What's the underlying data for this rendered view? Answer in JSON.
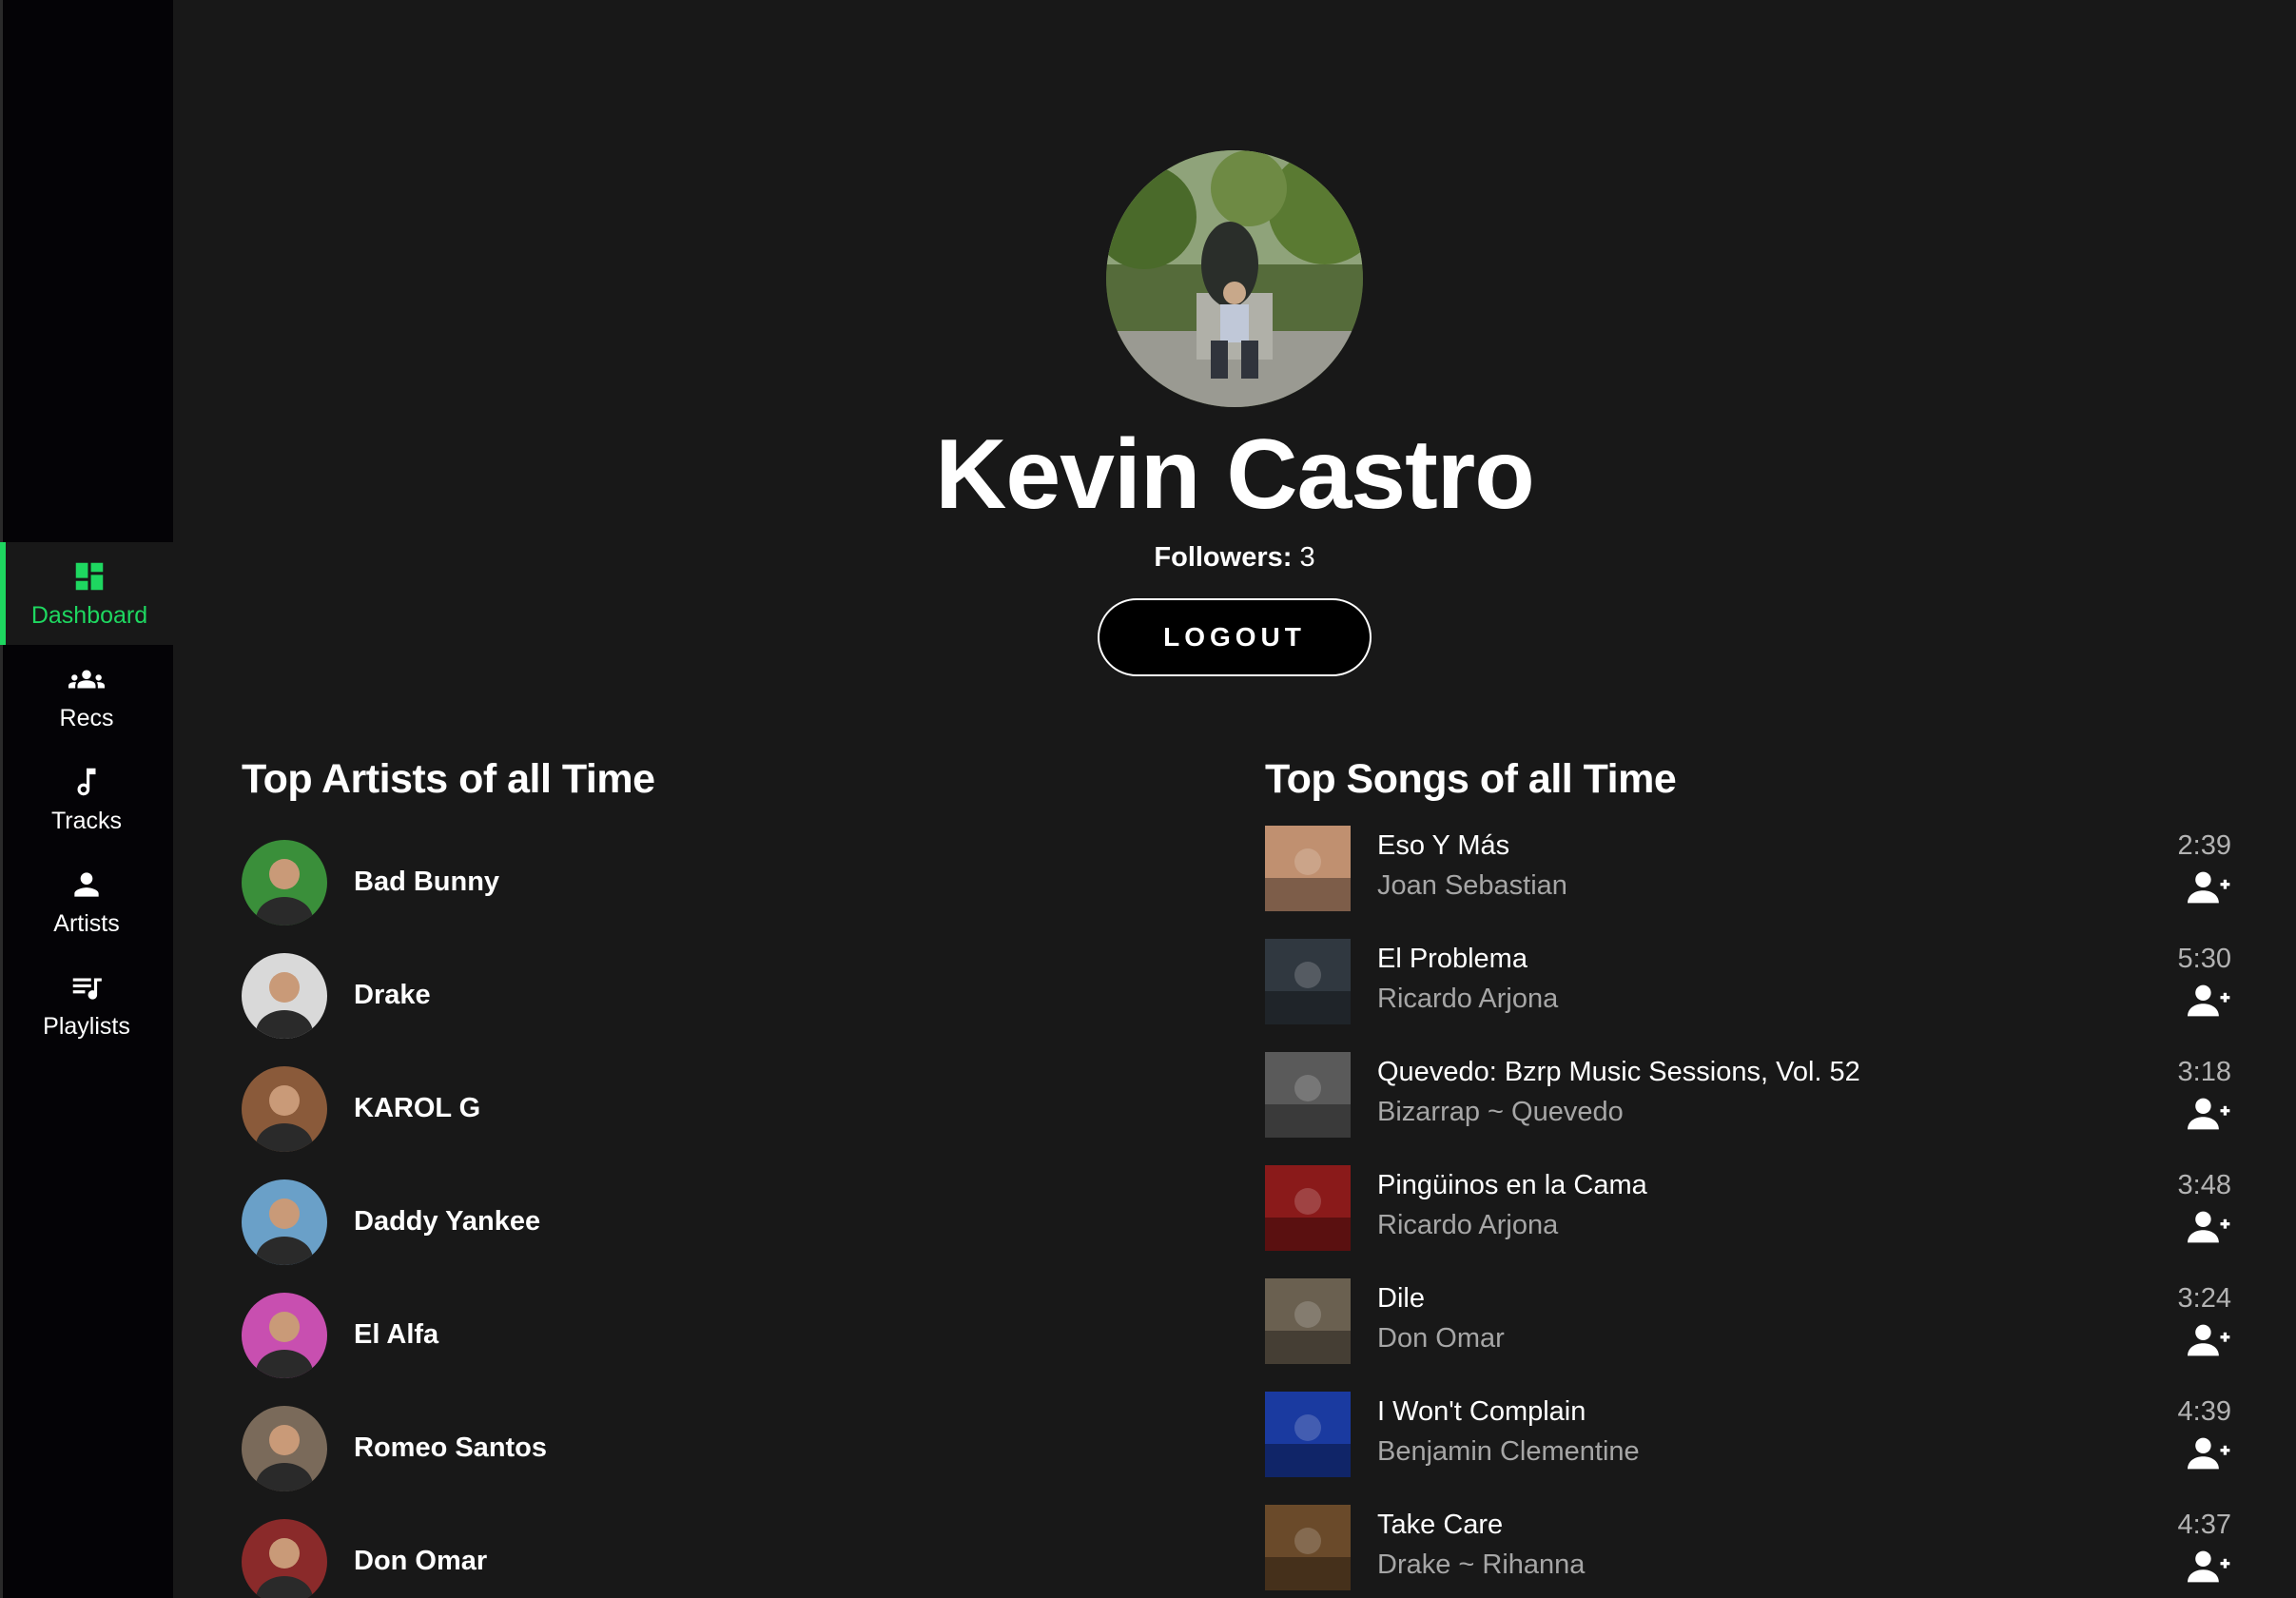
{
  "sidebar": {
    "items": [
      {
        "label": "Dashboard",
        "icon": "dashboard-icon",
        "active": true
      },
      {
        "label": "Recs",
        "icon": "group-icon"
      },
      {
        "label": "Tracks",
        "icon": "music-note-icon"
      },
      {
        "label": "Artists",
        "icon": "person-icon"
      },
      {
        "label": "Playlists",
        "icon": "playlist-icon"
      }
    ]
  },
  "profile": {
    "name": "Kevin Castro",
    "followers_label": "Followers:",
    "followers_count": "3",
    "logout_label": "LOGOUT"
  },
  "artists": {
    "title": "Top Artists of all Time",
    "items": [
      {
        "name": "Bad Bunny",
        "color": "#3a8f3a"
      },
      {
        "name": "Drake",
        "color": "#d9d9d9"
      },
      {
        "name": "KAROL G",
        "color": "#8a5a3a"
      },
      {
        "name": "Daddy Yankee",
        "color": "#6aa0c8"
      },
      {
        "name": "El Alfa",
        "color": "#c84fb0"
      },
      {
        "name": "Romeo Santos",
        "color": "#7a6a5a"
      },
      {
        "name": "Don Omar",
        "color": "#8a2a2a"
      }
    ]
  },
  "songs": {
    "title": "Top Songs of all Time",
    "items": [
      {
        "title": "Eso Y Más",
        "artist": "Joan Sebastian",
        "duration": "2:39",
        "color": "#c09070"
      },
      {
        "title": "El Problema",
        "artist": "Ricardo Arjona",
        "duration": "5:30",
        "color": "#303840"
      },
      {
        "title": "Quevedo: Bzrp Music Sessions, Vol. 52",
        "artist": "Bizarrap ~ Quevedo",
        "duration": "3:18",
        "color": "#5a5a5a"
      },
      {
        "title": "Pingüinos en la Cama",
        "artist": "Ricardo Arjona",
        "duration": "3:48",
        "color": "#8a1a1a"
      },
      {
        "title": "Dile",
        "artist": "Don Omar",
        "duration": "3:24",
        "color": "#6a6050"
      },
      {
        "title": "I Won't Complain",
        "artist": "Benjamin Clementine",
        "duration": "4:39",
        "color": "#1a3aa0"
      },
      {
        "title": "Take Care",
        "artist": "Drake ~ Rihanna",
        "duration": "4:37",
        "color": "#6a4a2a"
      }
    ]
  }
}
